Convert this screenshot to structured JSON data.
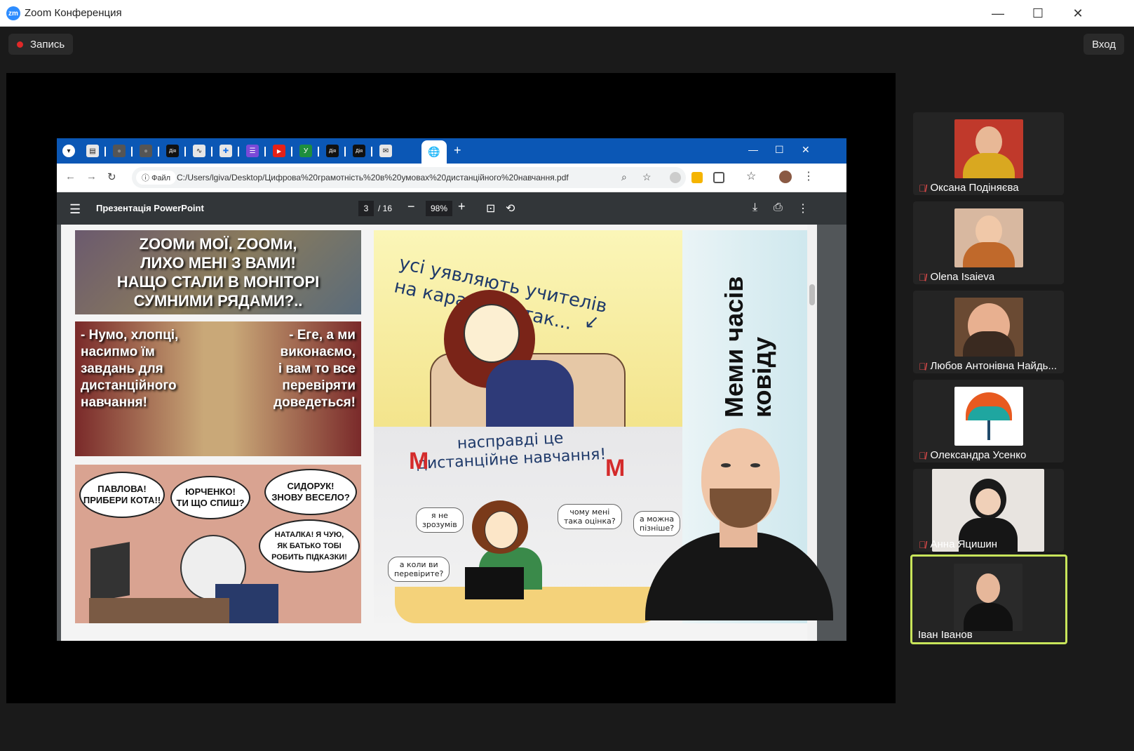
{
  "window": {
    "logo": "zm",
    "title": "Zoom Конференция",
    "minimize": "—",
    "maximize": "☐",
    "close": "✕"
  },
  "zoom": {
    "record_label": "Запись",
    "enter_label": "Вход"
  },
  "browser": {
    "url_chip": "ⓘ Файл",
    "url": "C:/Users/lgiva/Desktop/Цифрова%20грамотність%20в%20умовах%20дистанційного%20навчання.pdf",
    "new_tab": "+",
    "tab_icons": [
      "▾",
      "▤",
      "●",
      "●",
      "Дія",
      "∿",
      "✚",
      "☰",
      "▶",
      "У",
      "Дія",
      "Дія",
      "✉"
    ]
  },
  "pdf": {
    "title": "Презентація PowerPoint",
    "page_current": "3",
    "page_total": "/ 16",
    "zoom": "98%"
  },
  "slide": {
    "meme1_text": "ZOOMи МОЇ, ZOOMи,\nЛИХО МЕНІ З ВАМИ!\nНАЩО СТАЛИ В МОНІТОРІ\nСУМНИМИ РЯДАМИ?..",
    "meme2_left": "- Нумо, хлопці,\nнасипмо їм\nзавдань для\nдистанційного\nнавчання!",
    "meme2_right": "- Еге, а ми\nвиконаємо,\nі вам то все\nперевіряти\nдоведеться!",
    "meme3_b1": "ПАВЛОВА!\nПРИБЕРИ КОТА!!",
    "meme3_b2": "ЮРЧЕНКО!\nТИ ЩО СПИШ?",
    "meme3_b3": "СИДОРУК!\nЗНОВУ ВЕСЕЛО?",
    "meme3_b4": "НАТАЛКА! Я ЧУЮ,\nЯК БАТЬКО ТОБІ\nРОБИТЬ ПІДКАЗКИ!",
    "meme4_text": "усі уявляють учителів\nна карантині так...",
    "meme5_head": "насправді це\nдистанційне навчання!",
    "meme5_s1": "я не\nзрозумів",
    "meme5_s2": "чому мені\nтака оцінка?",
    "meme5_s3": "а можна\nпізніше?",
    "meme5_s4": "а коли ви\nперевірите?",
    "side_title": "Меми часів\nковіду"
  },
  "participants": [
    {
      "name": "Оксана Подіняєва",
      "muted": true,
      "bg": "#c0392b"
    },
    {
      "name": "Olena Isaieva",
      "muted": true,
      "bg": "#d8b8a0"
    },
    {
      "name": "Любов Антонівна Найдь...",
      "muted": true,
      "bg": "#6a4a33"
    },
    {
      "name": "Олександра Усенко",
      "muted": true,
      "bg": "#ffffff"
    },
    {
      "name": "Анна Яцишин",
      "muted": true,
      "bg": "#e8e4e0"
    },
    {
      "name": "Іван Іванов",
      "muted": false,
      "bg": "#2a2a2a"
    }
  ],
  "icons": [
    "mic-muted-icon",
    "record-dot-icon",
    "menu-icon",
    "download-icon",
    "print-icon",
    "more-icon",
    "rotate-icon",
    "fit-page-icon",
    "zoom-out-icon",
    "zoom-in-icon",
    "search-icon",
    "star-icon",
    "extensions-icon",
    "profile-icon"
  ]
}
